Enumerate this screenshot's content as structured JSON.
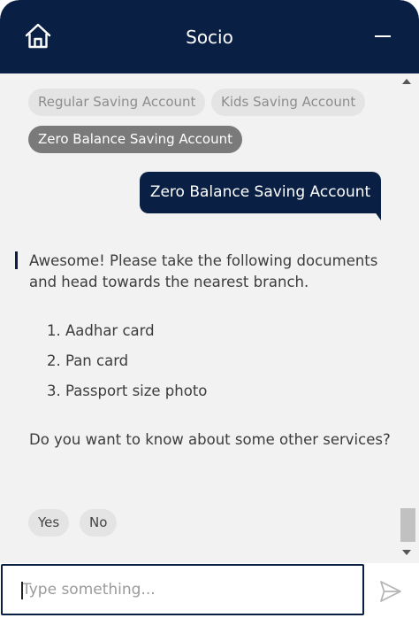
{
  "header": {
    "title": "Socio",
    "home_icon": "home-icon",
    "minimize_icon": "minimize-icon"
  },
  "chat": {
    "options": [
      {
        "label": "Regular Saving Account",
        "selected": false
      },
      {
        "label": "Kids Saving Account",
        "selected": false
      },
      {
        "label": "Zero Balance Saving Account",
        "selected": true
      }
    ],
    "user_message": "Zero Balance Saving Account",
    "bot_message": {
      "intro": "Awesome! Please take the following documents and head towards the nearest branch.",
      "documents": [
        "1. Aadhar card",
        "2. Pan card",
        "3. Passport size photo"
      ],
      "question": "Do you want to know about some other services?"
    },
    "quick_replies": [
      "Yes",
      "No"
    ]
  },
  "composer": {
    "placeholder": "Type something...",
    "send_icon": "send-icon"
  },
  "colors": {
    "brand_navy": "#0a1f44",
    "chat_background": "#f2f2f2",
    "chip_background": "#e4e4e4",
    "chip_selected": "#7a7a7a"
  }
}
